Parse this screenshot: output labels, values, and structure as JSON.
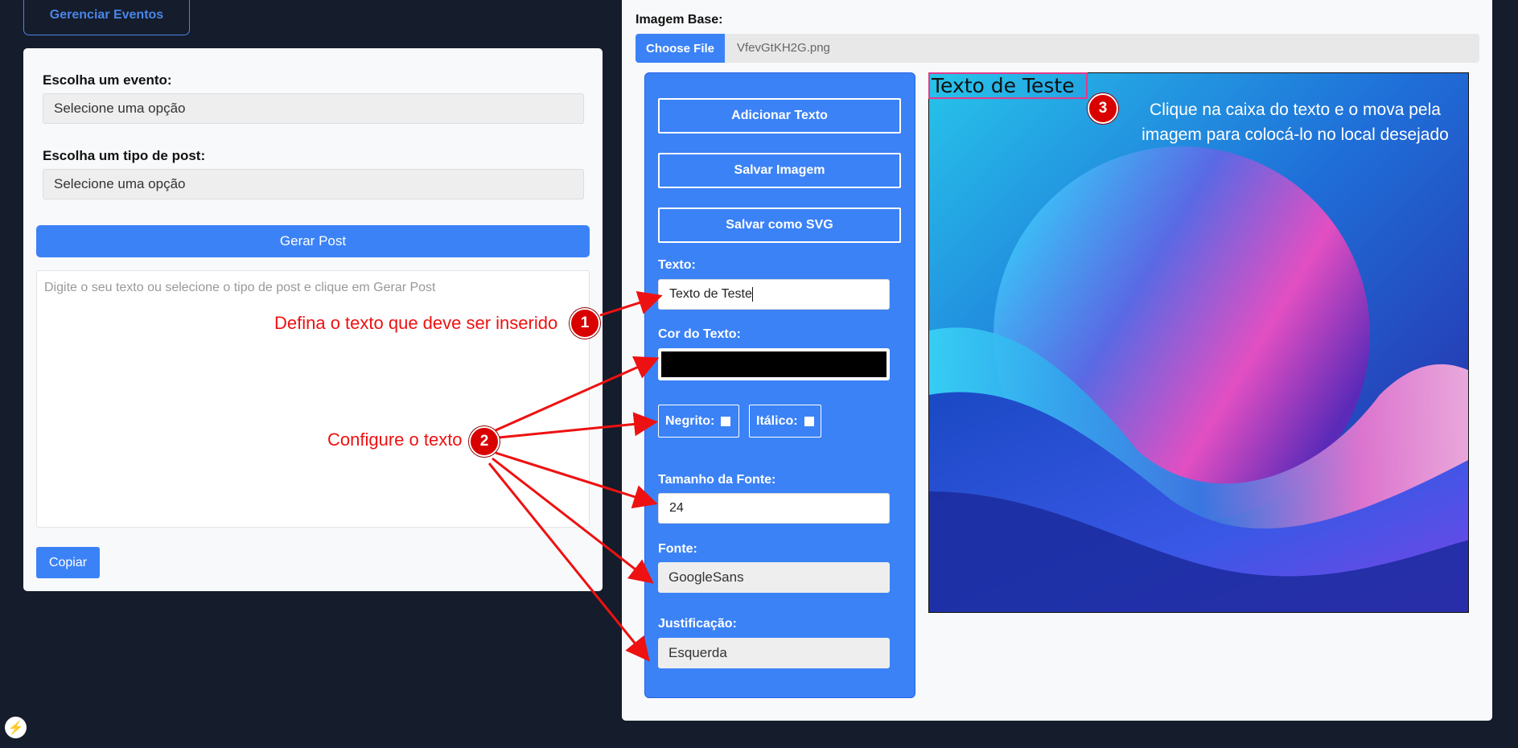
{
  "header": {
    "manage_events_label": "Gerenciar Eventos"
  },
  "form": {
    "event_label": "Escolha um evento:",
    "event_value": "Selecione uma opção",
    "post_type_label": "Escolha um tipo de post:",
    "post_type_value": "Selecione uma opção",
    "generate_label": "Gerar Post",
    "textarea_placeholder": "Digite o seu texto ou selecione o tipo de post e clique em Gerar Post",
    "copy_label": "Copiar"
  },
  "editor": {
    "base_image_label": "Imagem Base:",
    "choose_file_label": "Choose File",
    "file_name": "VfevGtKH2G.png",
    "add_text_label": "Adicionar Texto",
    "save_image_label": "Salvar Imagem",
    "save_svg_label": "Salvar como SVG",
    "text_label": "Texto:",
    "text_value": "Texto de Teste",
    "color_label": "Cor do Texto:",
    "color_value": "#000000",
    "bold_label": "Negrito:",
    "italic_label": "Itálico:",
    "font_size_label": "Tamanho da Fonte:",
    "font_size_value": "24",
    "font_label": "Fonte:",
    "font_value": "GoogleSans",
    "justify_label": "Justificação:",
    "justify_value": "Esquerda",
    "canvas_text": "Texto de Teste"
  },
  "annotations": {
    "step1_number": "1",
    "step1_text": "Defina o texto que deve ser inserido",
    "step2_number": "2",
    "step2_text": "Configure o texto",
    "step3_number": "3",
    "step3_line1": "Clique na caixa do texto e o mova pela",
    "step3_line2": "imagem para colocá-lo no local desejado"
  },
  "icons": {
    "corner_badge": "lightning-icon"
  },
  "colors": {
    "accent": "#3b82f6",
    "annotation_red": "#ee1111",
    "background": "#151c2b",
    "text_box_border": "#e33b8a"
  }
}
